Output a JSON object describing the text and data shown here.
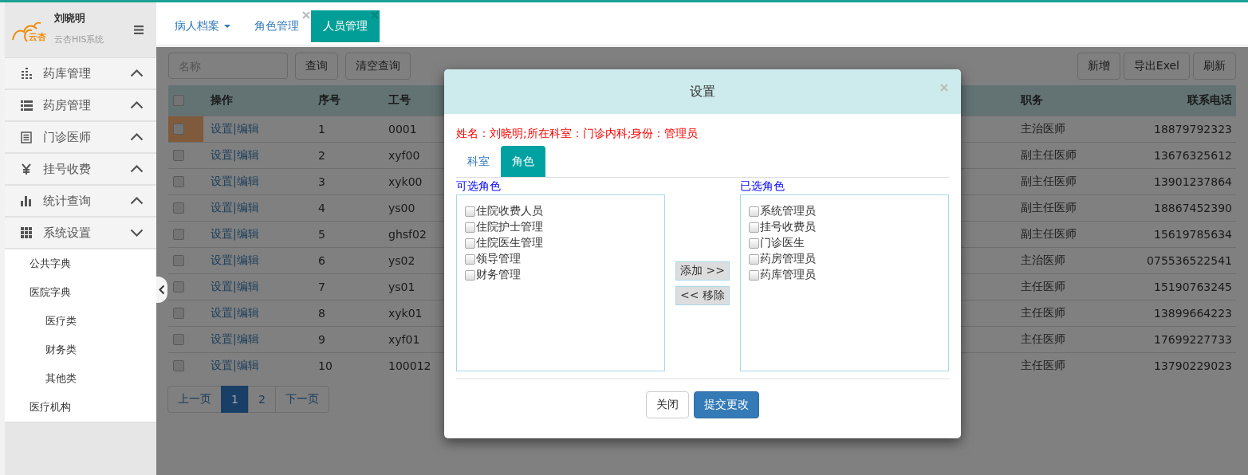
{
  "sidebar": {
    "logo_text": "云杏",
    "user_name": "刘晓明",
    "system_name": "云杏HIS系统",
    "menu": [
      {
        "label": "药库管理",
        "expanded": false
      },
      {
        "label": "药房管理",
        "expanded": false
      },
      {
        "label": "门诊医师",
        "expanded": false
      },
      {
        "label": "挂号收费",
        "expanded": false
      },
      {
        "label": "统计查询",
        "expanded": false
      },
      {
        "label": "系统设置",
        "expanded": true,
        "children": [
          {
            "label": "公共字典"
          },
          {
            "label": "医院字典",
            "children": [
              {
                "label": "医疗类"
              },
              {
                "label": "财务类"
              },
              {
                "label": "其他类"
              }
            ]
          },
          {
            "label": "医疗机构"
          }
        ]
      }
    ]
  },
  "tabs": [
    {
      "label": "病人档案",
      "kind": "dropdown",
      "closable": false,
      "selected": false
    },
    {
      "label": "角色管理",
      "kind": "plain",
      "closable": true,
      "selected": false
    },
    {
      "label": "人员管理",
      "kind": "plain",
      "closable": true,
      "selected": true
    }
  ],
  "toolbar": {
    "search": {
      "placeholder": "名称"
    },
    "left_buttons": [
      "查询",
      "清空查询"
    ],
    "right_buttons": [
      "新增",
      "导出Exel",
      "刷新"
    ]
  },
  "table": {
    "all_checked": false,
    "columns": [
      "操作",
      "序号",
      "工号",
      "职务",
      "联系电话"
    ],
    "rows": [
      {
        "selected": true,
        "checked": false,
        "action": "设置|编辑",
        "no": "1",
        "id": "0001",
        "title": "主治医师",
        "phone": "18879792323"
      },
      {
        "selected": false,
        "checked": false,
        "action": "设置|编辑",
        "no": "2",
        "id": "xyf00",
        "title": "副主任医师",
        "phone": "13676325612"
      },
      {
        "selected": false,
        "checked": false,
        "action": "设置|编辑",
        "no": "3",
        "id": "xyk00",
        "title": "副主任医师",
        "phone": "13901237864"
      },
      {
        "selected": false,
        "checked": false,
        "action": "设置|编辑",
        "no": "4",
        "id": "ys00",
        "title": "副主任医师",
        "phone": "18867452390"
      },
      {
        "selected": false,
        "checked": false,
        "action": "设置|编辑",
        "no": "5",
        "id": "ghsf02",
        "title": "副主任医师",
        "phone": "15619785634"
      },
      {
        "selected": false,
        "checked": false,
        "action": "设置|编辑",
        "no": "6",
        "id": "ys02",
        "title": "主治医师",
        "phone": "075536522541"
      },
      {
        "selected": false,
        "checked": false,
        "action": "设置|编辑",
        "no": "7",
        "id": "ys01",
        "title": "主任医师",
        "phone": "15190763245"
      },
      {
        "selected": false,
        "checked": false,
        "action": "设置|编辑",
        "no": "8",
        "id": "xyk01",
        "title": "主任医师",
        "phone": "13899664223"
      },
      {
        "selected": false,
        "checked": false,
        "action": "设置|编辑",
        "no": "9",
        "id": "xyf01",
        "title": "主任医师",
        "phone": "17699227733"
      },
      {
        "selected": false,
        "checked": false,
        "action": "设置|编辑",
        "no": "10",
        "id": "100012",
        "title": "主任医师",
        "phone": "13790229023"
      }
    ]
  },
  "pagination": {
    "prev": "上一页",
    "pages": [
      {
        "label": "1",
        "selected": true
      },
      {
        "label": "2",
        "selected": false
      }
    ],
    "next": "下一页"
  },
  "modal": {
    "title": "设置",
    "info": "姓名：刘晓明;所在科室：门诊内科;身份：管理员",
    "tabs": [
      {
        "label": "科室",
        "selected": false
      },
      {
        "label": "角色",
        "selected": true
      }
    ],
    "available": {
      "label": "可选角色",
      "items": [
        {
          "label": "住院收费人员",
          "checked": false
        },
        {
          "label": "住院护士管理",
          "checked": false
        },
        {
          "label": "住院医生管理",
          "checked": false
        },
        {
          "label": "领导管理",
          "checked": false
        },
        {
          "label": "财务管理",
          "checked": false
        }
      ]
    },
    "add_button": "添加 >>",
    "remove_button": "<< 移除",
    "chosen": {
      "label": "已选角色",
      "items": [
        {
          "label": "系统管理员",
          "checked": false
        },
        {
          "label": "挂号收费员",
          "checked": false
        },
        {
          "label": "门诊医生",
          "checked": false
        },
        {
          "label": "药房管理员",
          "checked": false
        },
        {
          "label": "药库管理员",
          "checked": false
        }
      ]
    },
    "buttons": [
      {
        "label": "关闭",
        "kind": "default"
      },
      {
        "label": "提交更改",
        "kind": "primary"
      }
    ]
  }
}
